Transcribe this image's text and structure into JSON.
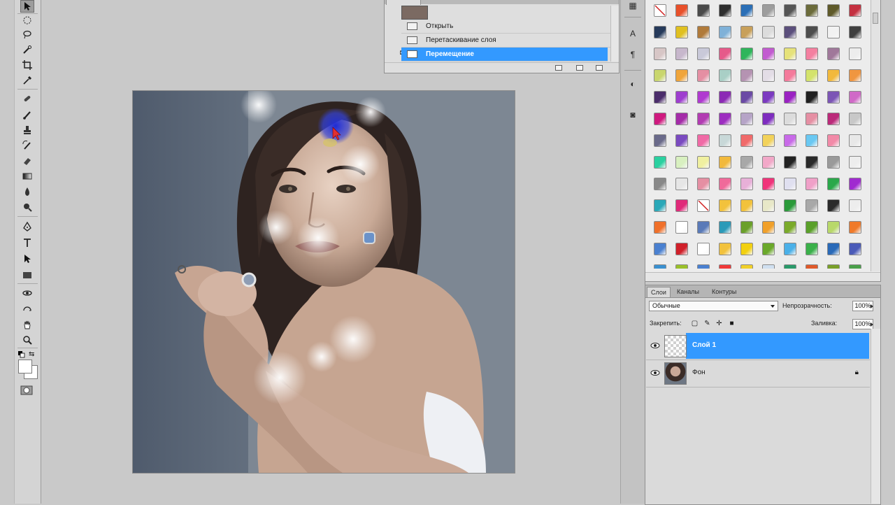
{
  "history": {
    "items": [
      {
        "label": "Открыть",
        "selected": false
      },
      {
        "label": "Перетаскивание слоя",
        "selected": false
      },
      {
        "label": "Перемещение",
        "selected": true
      }
    ]
  },
  "layers_panel": {
    "tabs": [
      {
        "label": "Слои",
        "active": true
      },
      {
        "label": "Каналы",
        "active": false
      },
      {
        "label": "Контуры",
        "active": false
      }
    ],
    "blend_mode": "Обычные",
    "opacity_label": "Непрозрачность:",
    "opacity_value": "100%",
    "lock_label": "Закрепить:",
    "fill_label": "Заливка:",
    "fill_value": "100%",
    "layers": [
      {
        "name": "Слой 1",
        "selected": true,
        "visible": true,
        "locked": false
      },
      {
        "name": "Фон",
        "selected": false,
        "visible": true,
        "locked": true
      }
    ]
  },
  "tools": [
    "move-icon",
    "marquee-icon",
    "lasso-icon",
    "quick-select-icon",
    "crop-icon",
    "eyedropper-icon",
    "spot-heal-icon",
    "brush-icon",
    "clone-stamp-icon",
    "history-brush-icon",
    "eraser-icon",
    "gradient-icon",
    "blur-icon",
    "dodge-icon",
    "pen-icon",
    "type-icon",
    "path-select-icon",
    "rectangle-icon",
    "3d-rotate-icon",
    "3d-orbit-icon",
    "hand-icon",
    "zoom-icon"
  ],
  "dock": [
    "brush-preset-icon",
    "character-icon",
    "paragraph-icon",
    "adjustments-icon",
    "masks-icon"
  ],
  "colors": {
    "selection_blue": "#3399ff",
    "foreground": "#ffffff",
    "background": "#ffffff"
  }
}
